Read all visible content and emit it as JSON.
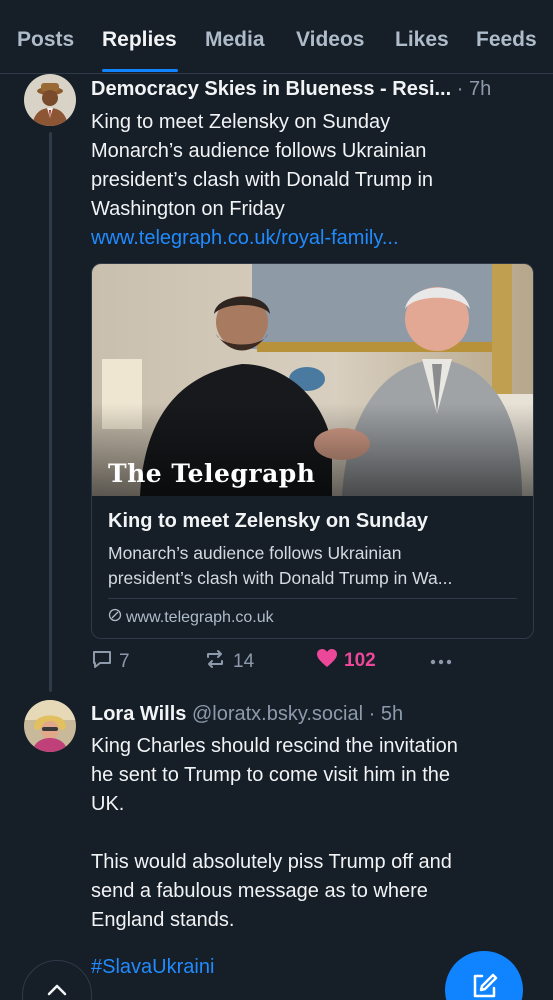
{
  "tabs": [
    {
      "label": "Posts"
    },
    {
      "label": "Replies"
    },
    {
      "label": "Media"
    },
    {
      "label": "Videos"
    },
    {
      "label": "Likes"
    },
    {
      "label": "Feeds"
    }
  ],
  "active_tab": "Replies",
  "post1": {
    "author": "Democracy Skies in Blueness - Resi...",
    "time": "· 7h",
    "text_lines": [
      "King to meet Zelensky on Sunday",
      "Monarch’s audience follows Ukrainian",
      "president’s clash with Donald Trump in",
      "Washington on Friday"
    ],
    "link": "www.telegraph.co.uk/royal-family...",
    "card": {
      "logo_text": "The Telegraph",
      "title": "King to meet Zelensky on Sunday",
      "desc_lines": [
        "Monarch’s audience follows Ukrainian",
        "president’s clash with Donald Trump in Wa..."
      ],
      "domain": "www.telegraph.co.uk"
    },
    "replies": "7",
    "reposts": "14",
    "likes": "102",
    "like_color": "#ec4899"
  },
  "post2": {
    "author": "Lora Wills",
    "handle": "@loratx.bsky.social",
    "time": "· 5h",
    "text_lines": [
      "King Charles should rescind the invitation",
      "he sent to Trump to come visit him in the",
      "UK.",
      "",
      "This would absolutely piss Trump off and",
      "send a fabulous message as to where",
      "England stands."
    ],
    "hashtag": "#SlavaUkraini"
  },
  "colors": {
    "background": "#161e27",
    "accent": "#1083fe",
    "link": "#208bfe",
    "muted": "#8d9aab"
  },
  "icons": {
    "reply": "speech-bubble-icon",
    "repost": "repost-arrows-icon",
    "like": "heart-icon",
    "more": "ellipsis-icon",
    "compose": "compose-pencil-icon",
    "scroll_top": "chevron-up-icon",
    "domain": "globe-icon"
  }
}
